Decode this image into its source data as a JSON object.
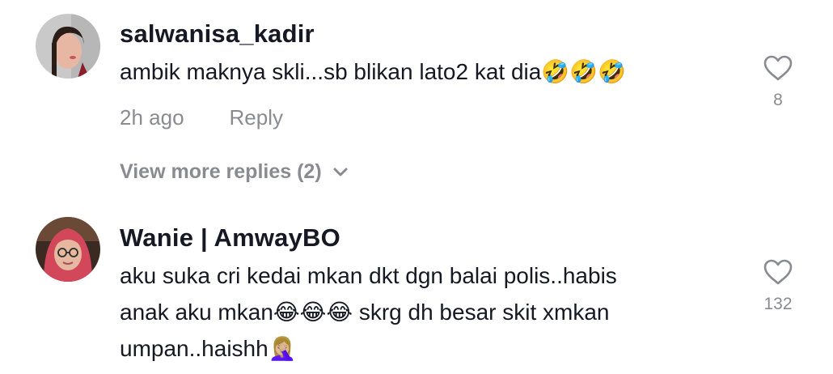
{
  "comments": [
    {
      "username": "salwanisa_kadir",
      "text": "ambik maknya skli...sb blikan lato2 kat dia🤣🤣🤣",
      "time": "2h ago",
      "reply_label": "Reply",
      "likes": "8",
      "avatar_icon": "profile-photo-woman"
    },
    {
      "username": "Wanie | AmwayBO",
      "text": "aku suka cri kedai mkan dkt dgn balai polis..habis\nanak aku mkan😂😂😂 skrg dh besar skit xmkan\numpan..haishh🤦🏼‍♀️",
      "likes": "132",
      "avatar_icon": "profile-photo-hijab-glasses"
    }
  ],
  "view_more_replies": "View more replies (2)",
  "icons": {
    "like": "heart-outline-icon",
    "expand": "chevron-down-icon"
  },
  "colors": {
    "primary_text": "#161823",
    "secondary_text": "#8a8b91"
  }
}
